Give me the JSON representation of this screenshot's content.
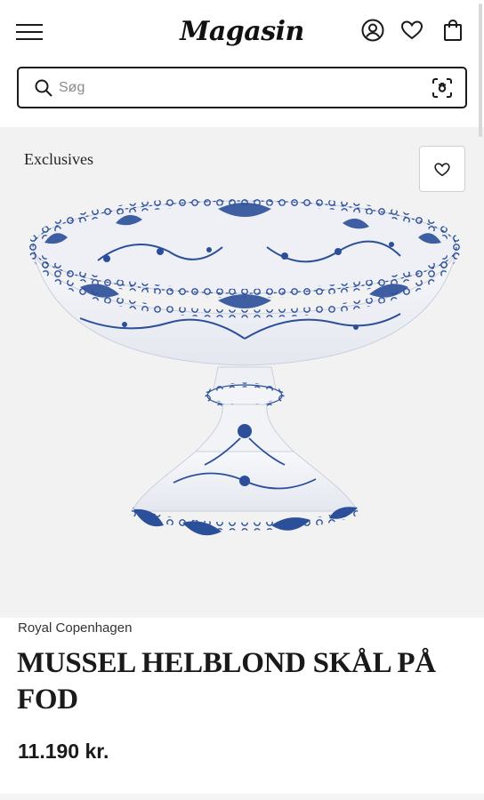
{
  "header": {
    "logo": "Magasin",
    "menu_icon": "hamburger-menu-icon",
    "account_icon": "account-icon",
    "wishlist_icon": "heart-icon",
    "bag_icon": "shopping-bag-icon"
  },
  "search": {
    "placeholder": "Søg",
    "value": "",
    "search_icon": "search-icon",
    "image_search_icon": "camera-scan-icon"
  },
  "product": {
    "badge": "Exclusives",
    "brand": "Royal Copenhagen",
    "title": "MUSSEL HELBLOND SKÅL PÅ FOD",
    "price": "11.190 kr.",
    "wishlist_icon": "heart-icon",
    "image": "blue-fluted-full-lace-footed-bowl"
  },
  "colors": {
    "accent": "#1a1a1a",
    "hero_bg": "#f2f2f2",
    "porcelain_blue": "#2c4f9a"
  }
}
